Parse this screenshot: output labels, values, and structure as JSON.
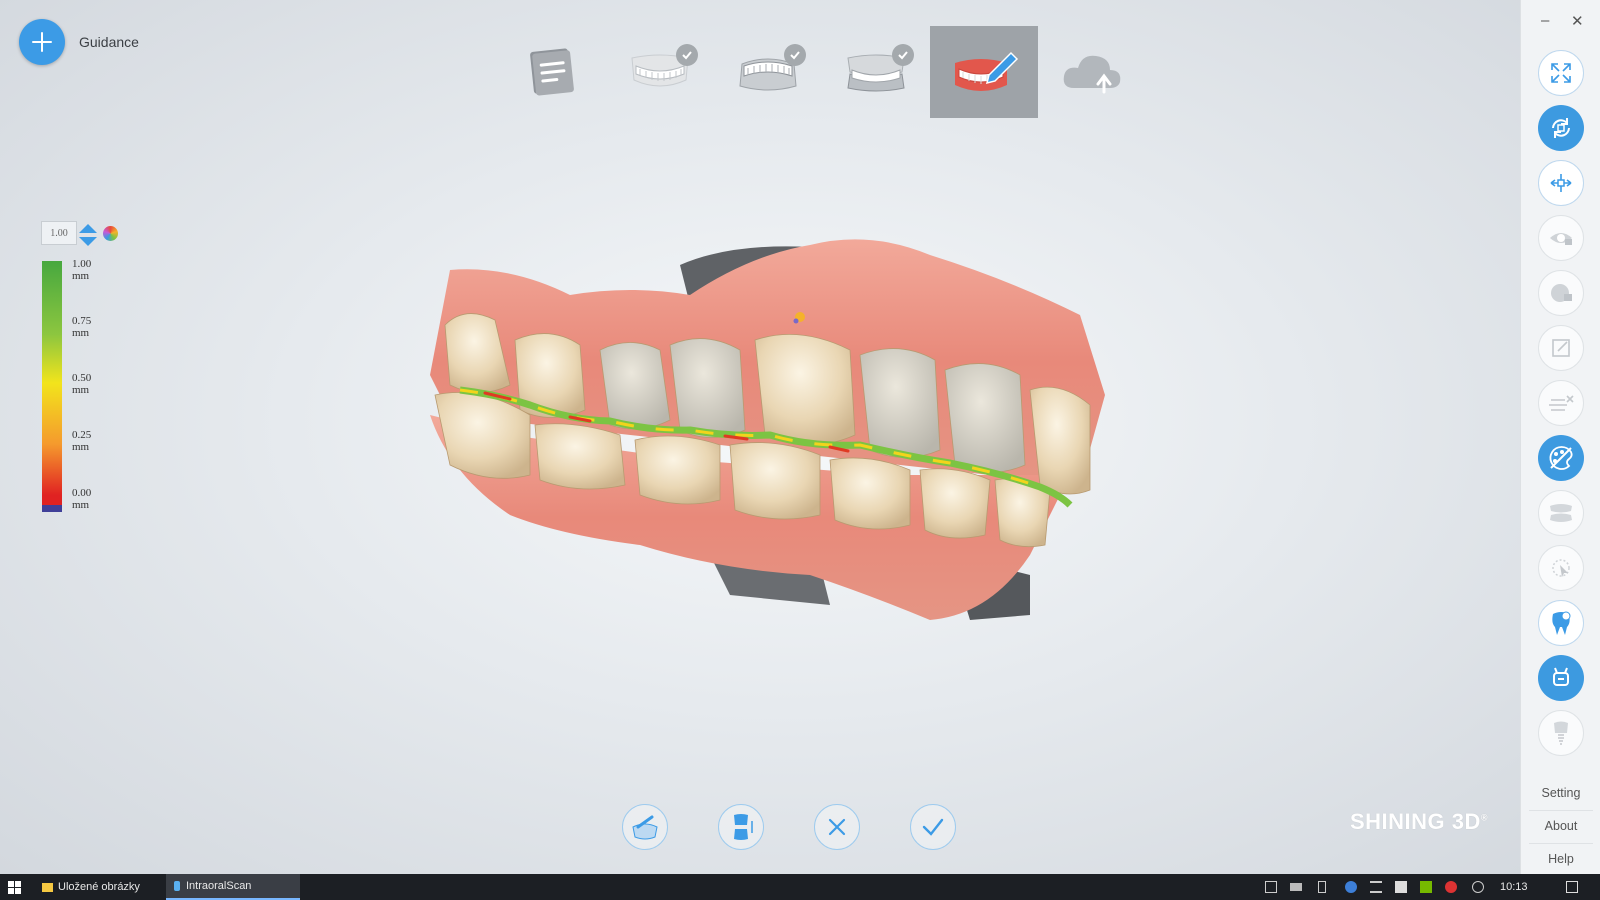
{
  "app": {
    "guidance_label": "Guidance",
    "accent": "#3c9be6",
    "brand": "SHINING 3D",
    "brand_mark": "®"
  },
  "steps": [
    {
      "name": "order-info",
      "icon": "document-icon",
      "completed": false,
      "active": false
    },
    {
      "name": "upper-jaw",
      "icon": "upper-jaw-icon",
      "completed": true,
      "active": false
    },
    {
      "name": "lower-jaw",
      "icon": "lower-jaw-icon",
      "completed": true,
      "active": false
    },
    {
      "name": "bite",
      "icon": "bite-icon",
      "completed": true,
      "active": false
    },
    {
      "name": "edit",
      "icon": "edit-jaw-icon",
      "completed": false,
      "active": true
    },
    {
      "name": "upload",
      "icon": "cloud-upload-icon",
      "completed": false,
      "active": false
    }
  ],
  "legend": {
    "value": "1.00",
    "ticks": [
      "1.00 mm",
      "0.75 mm",
      "0.50 mm",
      "0.25 mm",
      "0.00 mm"
    ]
  },
  "sidebar": {
    "tools": [
      {
        "name": "fit-view-icon",
        "state": "outline"
      },
      {
        "name": "rotate-icon",
        "state": "filled"
      },
      {
        "name": "pan-icon",
        "state": "outline"
      },
      {
        "name": "visibility-lock-icon",
        "state": "faded"
      },
      {
        "name": "texture-lock-icon",
        "state": "faded"
      },
      {
        "name": "edit-note-icon",
        "state": "faded"
      },
      {
        "name": "trim-plane-icon",
        "state": "faded"
      },
      {
        "name": "color-map-icon",
        "state": "filled"
      },
      {
        "name": "jaw-split-icon",
        "state": "faded"
      },
      {
        "name": "select-icon",
        "state": "faded"
      },
      {
        "name": "tooth-icon",
        "state": "outline"
      },
      {
        "name": "scanner-icon",
        "state": "filled"
      },
      {
        "name": "implant-icon",
        "state": "faded"
      }
    ],
    "links": [
      "Setting",
      "About",
      "Help"
    ]
  },
  "bottom_tools": [
    "trim-tool-icon",
    "tooth-segment-icon",
    "cancel-icon",
    "confirm-icon"
  ],
  "taskbar": {
    "items": [
      {
        "label": "Uložené obrázky",
        "active": false
      },
      {
        "label": "IntraoralScan",
        "active": true
      }
    ],
    "time": "10:13"
  }
}
